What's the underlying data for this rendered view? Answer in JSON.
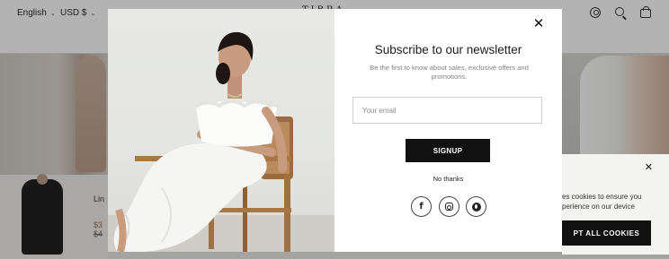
{
  "header": {
    "language": "English",
    "currency": "USD $",
    "logo_text": "TIBRA",
    "icons": [
      "account-icon",
      "search-icon",
      "bag-icon"
    ]
  },
  "background_product": {
    "name": "Lin",
    "price": "$3",
    "old_price": "$4"
  },
  "modal": {
    "title": "Subscribe to our newsletter",
    "subtitle": "Be the first to know about sales, exclusive offers and promotions.",
    "email_placeholder": "Your email",
    "email_value": "",
    "signup_label": "SIGNUP",
    "no_thanks_label": "No thanks",
    "socials": [
      "facebook-icon",
      "instagram-icon",
      "pinterest-icon"
    ],
    "facebook_glyph": "f"
  },
  "cookie_banner": {
    "text_line1": "es cookies to ensure you",
    "text_line2": "perience on our device",
    "accept_label": "PT ALL COOKIES"
  },
  "colors": {
    "button_bg": "#111111",
    "overlay": "rgba(20,20,20,0.32)"
  }
}
